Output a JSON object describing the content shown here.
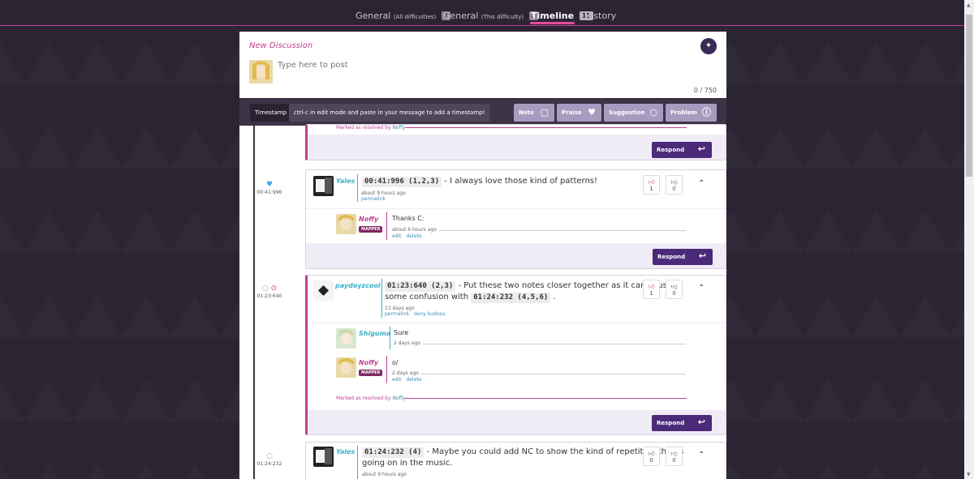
{
  "tabs": [
    {
      "label": "General",
      "sub": "(All difficulties)",
      "count": "7"
    },
    {
      "label": "General",
      "sub": "(This difficulty)",
      "count": "2"
    },
    {
      "label": "Timeline",
      "sub": "",
      "count": "15"
    },
    {
      "label": "History",
      "sub": "",
      "count": ""
    }
  ],
  "new_discussion": {
    "title": "New Discussion",
    "placeholder": "Type here to post",
    "counter": "0 / 750"
  },
  "toolbar": {
    "timestamp_label": "Timestamp",
    "hint": "ctrl-c in edit mode and paste in your message to add a timestamp!",
    "types": [
      "Note",
      "Praise",
      "Suggestion",
      "Problem"
    ]
  },
  "respond_label": "Respond",
  "resolved_text": "Marked as resolved by",
  "resolved_by": "Noffy",
  "mapper_badge": "MAPPER",
  "markers": [
    "00:41:996",
    "01:23:640",
    "01:24:232"
  ],
  "discussions": [
    {
      "user": "Yales",
      "timestamp": "00:41:996 (1,2,3)",
      "message": " - I always love those kind of patterns!",
      "time": "about 9 hours ago",
      "links": [
        "permalink"
      ],
      "up": "1",
      "down": "0",
      "replies": [
        {
          "user": "Noffy",
          "message": "Thanks C:",
          "time": "about 6 hours ago",
          "links": [
            "edit",
            "delete"
          ]
        }
      ]
    },
    {
      "user": "paydoyzcool",
      "timestamp": "01:23:640 (2,3)",
      "message_a": " - Put these two notes closer together as it can cause",
      "message_b": "some confusion with ",
      "timestamp2": "01:24:232 (4,5,6)",
      "message_c": " .",
      "time": "13 days ago",
      "links": [
        "permalink",
        "deny kudosu"
      ],
      "up": "1",
      "down": "0",
      "replies": [
        {
          "user": "Shiguma",
          "message": "Sure",
          "time": "2 days ago"
        },
        {
          "user": "Noffy",
          "message": "o/",
          "time": "2 days ago",
          "links": [
            "edit",
            "delete"
          ]
        }
      ]
    },
    {
      "user": "Yales",
      "timestamp": "01:24:232 (4)",
      "message_a": " - Maybe you could add NC to show the kind of repetition that is",
      "message_b": "going on in the music.",
      "time": "about 9 hours ago",
      "up": "0",
      "down": "0"
    }
  ]
}
